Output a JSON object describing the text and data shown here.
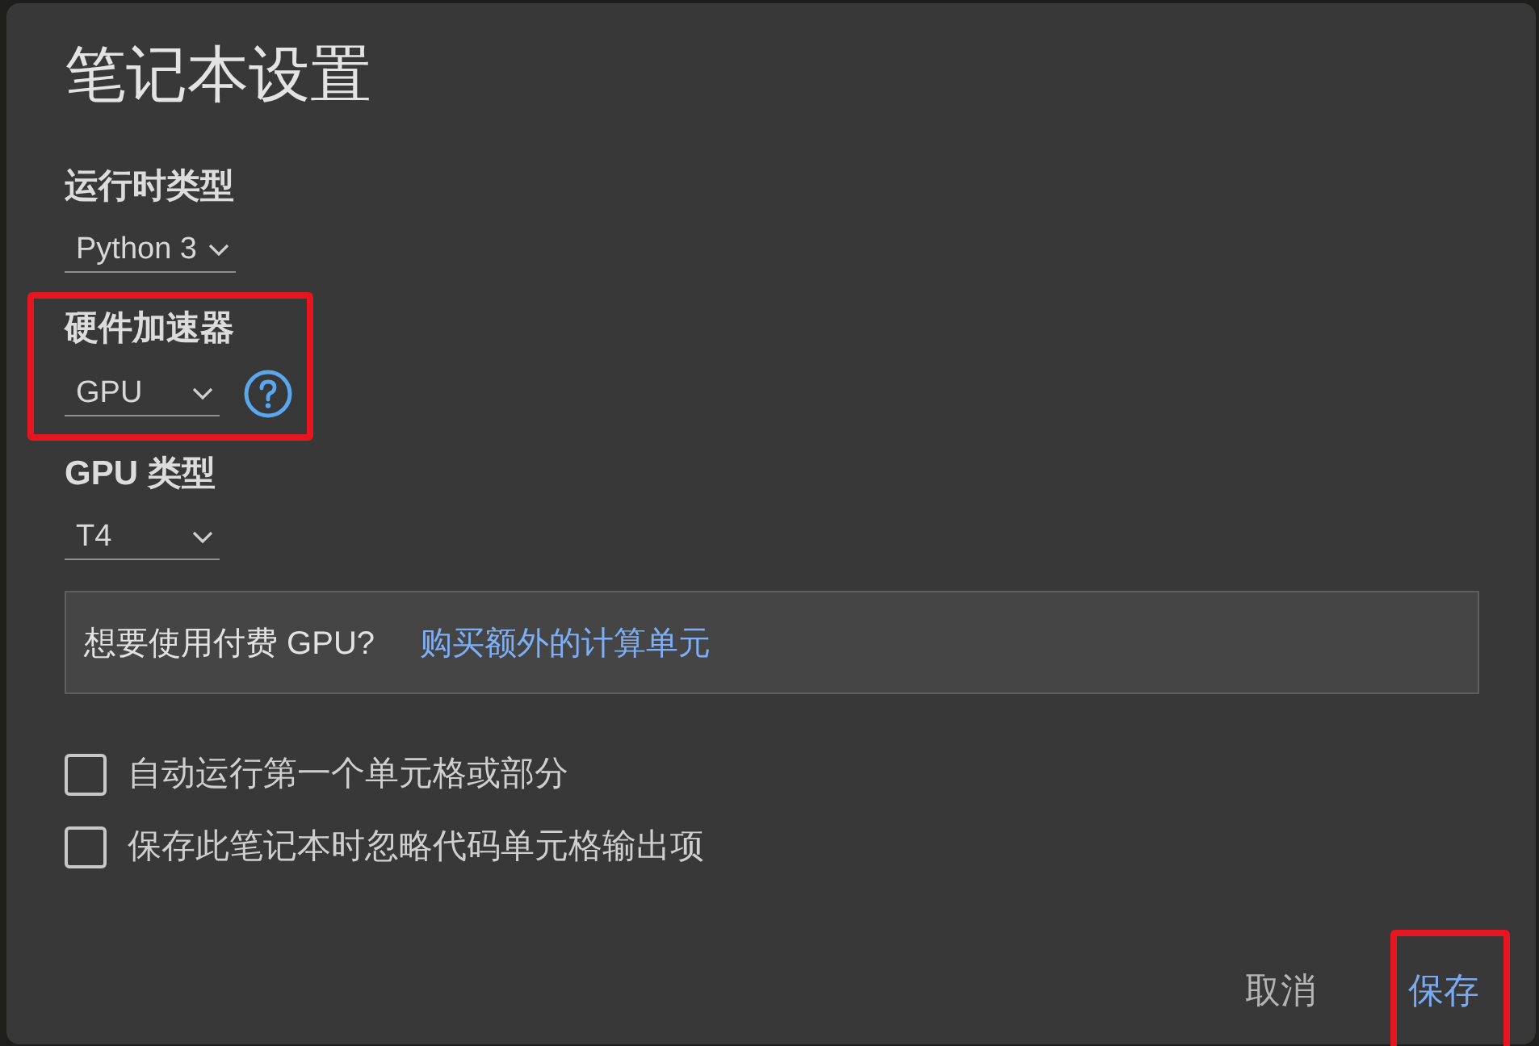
{
  "dialog": {
    "title": "笔记本设置"
  },
  "settings": [
    {
      "label": "运行时类型",
      "value": "Python 3",
      "help": false,
      "highlighted": false
    },
    {
      "label": "硬件加速器",
      "value": "GPU",
      "help": true,
      "highlighted": true
    },
    {
      "label": "GPU 类型",
      "value": "T4",
      "help": false,
      "highlighted": false
    }
  ],
  "banner": {
    "text": "想要使用付费 GPU?",
    "link": "购买额外的计算单元"
  },
  "options": [
    {
      "label": "自动运行第一个单元格或部分",
      "checked": false
    },
    {
      "label": "保存此笔记本时忽略代码单元格输出项",
      "checked": false
    }
  ],
  "buttons": [
    {
      "label": "取消",
      "kind": "secondary",
      "highlighted": false
    },
    {
      "label": "保存",
      "kind": "primary",
      "highlighted": true
    }
  ]
}
